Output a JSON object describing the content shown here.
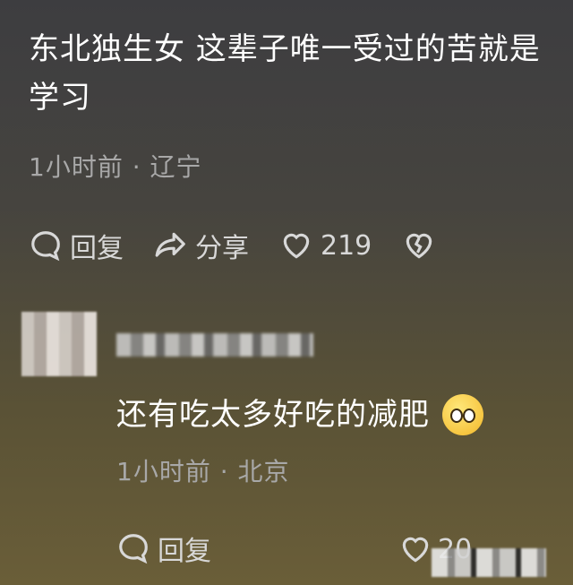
{
  "main_comment": {
    "text": "东北独生女 这辈子唯一受过的苦就是学习",
    "meta": "1小时前 · 辽宁",
    "actions": {
      "reply_label": "回复",
      "share_label": "分享",
      "like_count": "219"
    }
  },
  "reply": {
    "text": "还有吃太多好吃的减肥",
    "emoji": "pleading-face-icon",
    "meta": "1小时前 · 北京",
    "actions": {
      "reply_label": "回复",
      "like_count": "20"
    }
  }
}
